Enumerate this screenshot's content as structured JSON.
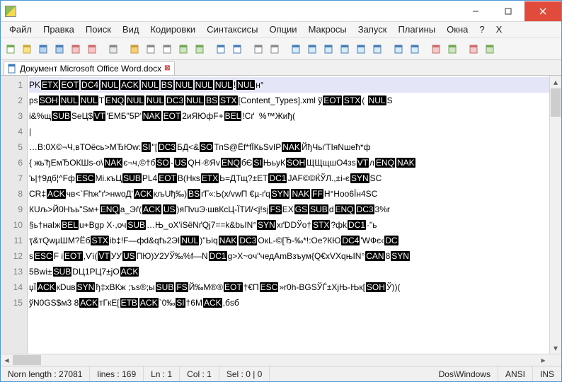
{
  "menus": [
    "Файл",
    "Правка",
    "Поиск",
    "Вид",
    "Кодировки",
    "Синтаксисы",
    "Опции",
    "Макросы",
    "Запуск",
    "Плагины",
    "Окна",
    "?",
    "X"
  ],
  "tab": {
    "label": "Документ Microsoft Office Word.docx"
  },
  "gutter": [
    "1",
    "2",
    "3",
    "4",
    "5",
    "6",
    "7",
    "8",
    "9",
    "10",
    "11",
    "12",
    "13",
    "14",
    "15"
  ],
  "lines": [
    [
      {
        "t": "PK"
      },
      {
        "c": "ETX"
      },
      {
        "c": "EOT"
      },
      {
        "c": "DC4"
      },
      {
        "c": "NUL"
      },
      {
        "c": "ACK"
      },
      {
        "c": "NUL"
      },
      {
        "c": "BS"
      },
      {
        "c": "NUL"
      },
      {
        "c": "NUL"
      },
      {
        "c": "NUL"
      },
      {
        "t": "!"
      },
      {
        "c": "NUL"
      },
      {
        "t": "н°"
      }
    ],
    [
      {
        "t": "ps"
      },
      {
        "c": "SOH"
      },
      {
        "c": "NUL"
      },
      {
        "c": "NUL"
      },
      {
        "t": "T"
      },
      {
        "c": "ENQ"
      },
      {
        "c": "NUL"
      },
      {
        "c": "NUL"
      },
      {
        "c": "DC3"
      },
      {
        "c": "NUL"
      },
      {
        "c": "BS"
      },
      {
        "c": "STX"
      },
      {
        "t": "[Content_Types].xml ў"
      },
      {
        "c": "EOT"
      },
      {
        "c": "STX"
      },
      {
        "t": "( "
      },
      {
        "c": "NUL"
      },
      {
        "t": "S"
      }
    ],
    [
      {
        "t": "і&%щ"
      },
      {
        "c": "SUB"
      },
      {
        "t": "SeЦ$"
      },
      {
        "c": "VT"
      },
      {
        "t": "'ЕМБ\"5Р'"
      },
      {
        "c": "NAK"
      },
      {
        "c": "EOT"
      },
      {
        "t": "2иЯЮфF+"
      },
      {
        "c": "BEL"
      },
      {
        "t": "!Сґ  %™Жиђ("
      }
    ],
    [
      {
        "t": "|"
      }
    ],
    [
      {
        "t": "…В:0Х©¬Ч,вТОёсь>МЂЮw:"
      },
      {
        "c": "SI"
      },
      {
        "t": "\"["
      },
      {
        "c": "DC3"
      },
      {
        "t": "БД<&"
      },
      {
        "c": "SO"
      },
      {
        "t": "ТпЅ@Ёf*fЇКьSvІР"
      },
      {
        "c": "NAK"
      },
      {
        "t": "ЙђЧы'ТІяNшећ*ф"
      }
    ],
    [
      {
        "t": "{ жь'ђЕмЂОКШs-о\\"
      },
      {
        "c": "NAK"
      },
      {
        "t": "є¬ч,©†б"
      },
      {
        "c": "SO"
      },
      {
        "t": "-"
      },
      {
        "c": "US"
      },
      {
        "t": "QH·®Яv"
      },
      {
        "c": "ENQ"
      },
      {
        "t": "бЄ"
      },
      {
        "c": "SI"
      },
      {
        "t": "ЊьуК"
      },
      {
        "c": "SOH"
      },
      {
        "t": "ЩЩщшО4зs"
      },
      {
        "c": "VT"
      },
      {
        "t": "л"
      },
      {
        "c": "ENQ"
      },
      {
        "c": "NAK"
      }
    ],
    [
      {
        "t": "'ь|†9дб¦^Fф"
      },
      {
        "c": "ESC"
      },
      {
        "t": "Мі.къЦ"
      },
      {
        "c": "SUB"
      },
      {
        "t": "PL4"
      },
      {
        "c": "EOT"
      },
      {
        "t": "B(Нкs"
      },
      {
        "c": "ETX"
      },
      {
        "t": "Ь=ДТщ?±ЕТ"
      },
      {
        "c": "DC1"
      },
      {
        "t": "JAF©©ЌЎЛ.,±i-є"
      },
      {
        "c": "SYN"
      },
      {
        "t": "SC"
      }
    ],
    [
      {
        "t": "СR‡"
      },
      {
        "c": "ACK"
      },
      {
        "t": "чв<`Fhж\"ґ>нwоД'"
      },
      {
        "c": "ACK"
      },
      {
        "t": "кљUђ‰)"
      },
      {
        "c": "BS"
      },
      {
        "t": "ґГ«:Ь(х/vwП €µ-ґq"
      },
      {
        "c": "SYN"
      },
      {
        "c": "NAK"
      },
      {
        "c": "FF"
      },
      {
        "t": "Н°Ноо6Їн4SC"
      }
    ],
    [
      {
        "t": "КUљ>Й0Нъь\"Sм+"
      },
      {
        "c": "ENQ"
      },
      {
        "t": "а_Эѓ("
      },
      {
        "c": "ACK"
      },
      {
        "c": "US"
      },
      {
        "t": ")яПvuЭ∙швКсЦ-ЇТИ/<ј!sј"
      },
      {
        "c": "FS"
      },
      {
        "t": "EX"
      },
      {
        "c": "GS"
      },
      {
        "c": "SUB"
      },
      {
        "t": "d"
      },
      {
        "c": "ENQ"
      },
      {
        "c": "DC3"
      },
      {
        "t": "3%r"
      }
    ],
    [
      {
        "t": "§ь†наІж"
      },
      {
        "c": "BEL"
      },
      {
        "t": "u+Вgр Х·,оч"
      },
      {
        "c": "SUB"
      },
      {
        "t": "…Њ_оХ'іЅёNґQј7==k&bьІN°"
      },
      {
        "c": "SYN"
      },
      {
        "t": "хґDDЎо†"
      },
      {
        "c": "STX"
      },
      {
        "t": "?фk"
      },
      {
        "c": "DC1"
      },
      {
        "t": "·\"ь"
      }
    ],
    [
      {
        "t": "ҭ&тQwµШМ?Ёб"
      },
      {
        "c": "STX"
      },
      {
        "t": "іb‡!F—фd&qfъ2ЭІ"
      },
      {
        "c": "NUL"
      },
      {
        "t": ")\"Ьiq"
      },
      {
        "c": "NAK"
      },
      {
        "c": "DC3"
      },
      {
        "t": "ОкL-©[Ђ-‰*!:Ое?КЮ"
      },
      {
        "c": "DC4"
      },
      {
        "t": "'WФє‹"
      },
      {
        "c": "DC"
      }
    ],
    [
      {
        "t": "s"
      },
      {
        "c": "ESC"
      },
      {
        "t": "F і"
      },
      {
        "c": "EOT"
      },
      {
        "t": ",Ѵі("
      },
      {
        "c": "VT"
      },
      {
        "t": "УУ"
      },
      {
        "c": "US"
      },
      {
        "t": "ПЮ)У2УЎ‰%f—N"
      },
      {
        "c": "DC1"
      },
      {
        "t": "g>Х~oч\"чедАmВзъум{Q€xVХqњІN°"
      },
      {
        "c": "CAN"
      },
      {
        "t": "8"
      },
      {
        "c": "SYN"
      }
    ],
    [
      {
        "t": "5Bwі±"
      },
      {
        "c": "SUB"
      },
      {
        "t": "DЦ1РЦ7±јО"
      },
      {
        "c": "ACK"
      }
    ],
    [
      {
        "t": "џЇ"
      },
      {
        "c": "ACK"
      },
      {
        "t": "кDuв"
      },
      {
        "c": "SYN"
      },
      {
        "t": "ђ‡хВКж ;ъs®;ы"
      },
      {
        "c": "SUB"
      },
      {
        "c": "FS"
      },
      {
        "t": "Й‰M®®"
      },
      {
        "c": "EOT"
      },
      {
        "t": "†€П"
      },
      {
        "c": "ESC"
      },
      {
        "t": "»r0h-ВGSЎЃ±ХјЊ-Њк["
      },
      {
        "c": "SOH"
      },
      {
        "t": "Ў))("
      }
    ],
    [
      {
        "t": "ўN0GS$м3 8"
      },
      {
        "c": "ACK"
      },
      {
        "t": "тГкЕ["
      },
      {
        "c": "ETB"
      },
      {
        "c": "ACK"
      },
      {
        "t": "`0‰"
      },
      {
        "c": "SI"
      },
      {
        "t": "†6M"
      },
      {
        "c": "ACK"
      },
      {
        "t": ",бsб"
      }
    ]
  ],
  "status": {
    "length": "Norn length : 27081",
    "lines": "lines : 169",
    "ln": "Ln : 1",
    "col": "Col : 1",
    "sel": "Sel : 0 | 0",
    "eol": "Dos\\Windows",
    "enc": "ANSI",
    "ins": "INS"
  },
  "toolbar_icons": [
    "new-file",
    "open-file",
    "save",
    "save-all",
    "close",
    "close-all",
    "print",
    "cut",
    "copy",
    "paste",
    "undo",
    "redo",
    "find",
    "replace",
    "zoom-in",
    "zoom-out",
    "sync",
    "word-wrap",
    "show-all",
    "indent-guide",
    "fold",
    "unfold",
    "bookmark",
    "record",
    "play",
    "stop",
    "record-macro",
    "play-macro"
  ]
}
